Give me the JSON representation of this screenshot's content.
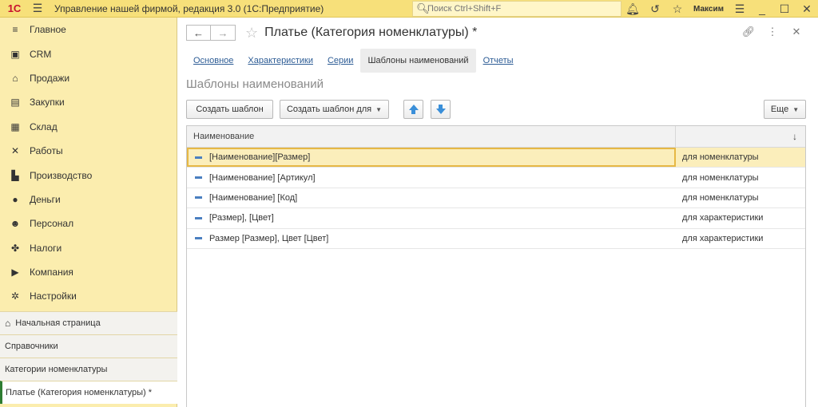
{
  "titlebar": {
    "logo": "1C",
    "title": "Управление нашей фирмой, редакция 3.0  (1С:Предприятие)",
    "search_placeholder": "Поиск Ctrl+Shift+F",
    "user": "Максим"
  },
  "sidebar": {
    "items": [
      {
        "label": "Главное",
        "icon": "menu-icon"
      },
      {
        "label": "CRM",
        "icon": "crm-icon"
      },
      {
        "label": "Продажи",
        "icon": "shop-icon"
      },
      {
        "label": "Закупки",
        "icon": "purchases-icon"
      },
      {
        "label": "Склад",
        "icon": "warehouse-icon"
      },
      {
        "label": "Работы",
        "icon": "tools-icon"
      },
      {
        "label": "Производство",
        "icon": "factory-icon"
      },
      {
        "label": "Деньги",
        "icon": "money-icon"
      },
      {
        "label": "Персонал",
        "icon": "people-icon"
      },
      {
        "label": "Налоги",
        "icon": "eagle-icon"
      },
      {
        "label": "Компания",
        "icon": "flag-icon"
      },
      {
        "label": "Настройки",
        "icon": "gear-icon"
      }
    ],
    "open_windows": [
      {
        "label": "Начальная страница"
      },
      {
        "label": "Справочники"
      },
      {
        "label": "Категории номенклатуры"
      },
      {
        "label": "Платье (Категория номенклатуры) *"
      }
    ]
  },
  "form": {
    "title": "Платье (Категория номенклатуры) *",
    "tabs": [
      {
        "label": "Основное",
        "active": false
      },
      {
        "label": "Характеристики",
        "active": false
      },
      {
        "label": "Серии",
        "active": false
      },
      {
        "label": "Шаблоны наименований",
        "active": true
      },
      {
        "label": "Отчеты",
        "active": false
      }
    ],
    "section_title": "Шаблоны наименований",
    "toolbar": {
      "create_template": "Создать шаблон",
      "create_template_for": "Создать шаблон для",
      "more": "Еще"
    },
    "grid": {
      "col_name": "Наименование",
      "sort_indicator": "↓",
      "rows": [
        {
          "name": "[Наименование][Размер]",
          "type": "для номенклатуры",
          "selected": true
        },
        {
          "name": "[Наименование] [Артикул]",
          "type": "для номенклатуры",
          "selected": false
        },
        {
          "name": "[Наименование] [Код]",
          "type": "для номенклатуры",
          "selected": false
        },
        {
          "name": "[Размер], [Цвет]",
          "type": "для характеристики",
          "selected": false
        },
        {
          "name": "Размер [Размер], Цвет [Цвет]",
          "type": "для характеристики",
          "selected": false
        }
      ]
    }
  },
  "colors": {
    "titlebar_bg": "#f7e07a",
    "sidebar_bg": "#fbedae",
    "link": "#2d5c95",
    "selected_row": "#fbeebb",
    "arrow_blue": "#3a8fd9"
  }
}
